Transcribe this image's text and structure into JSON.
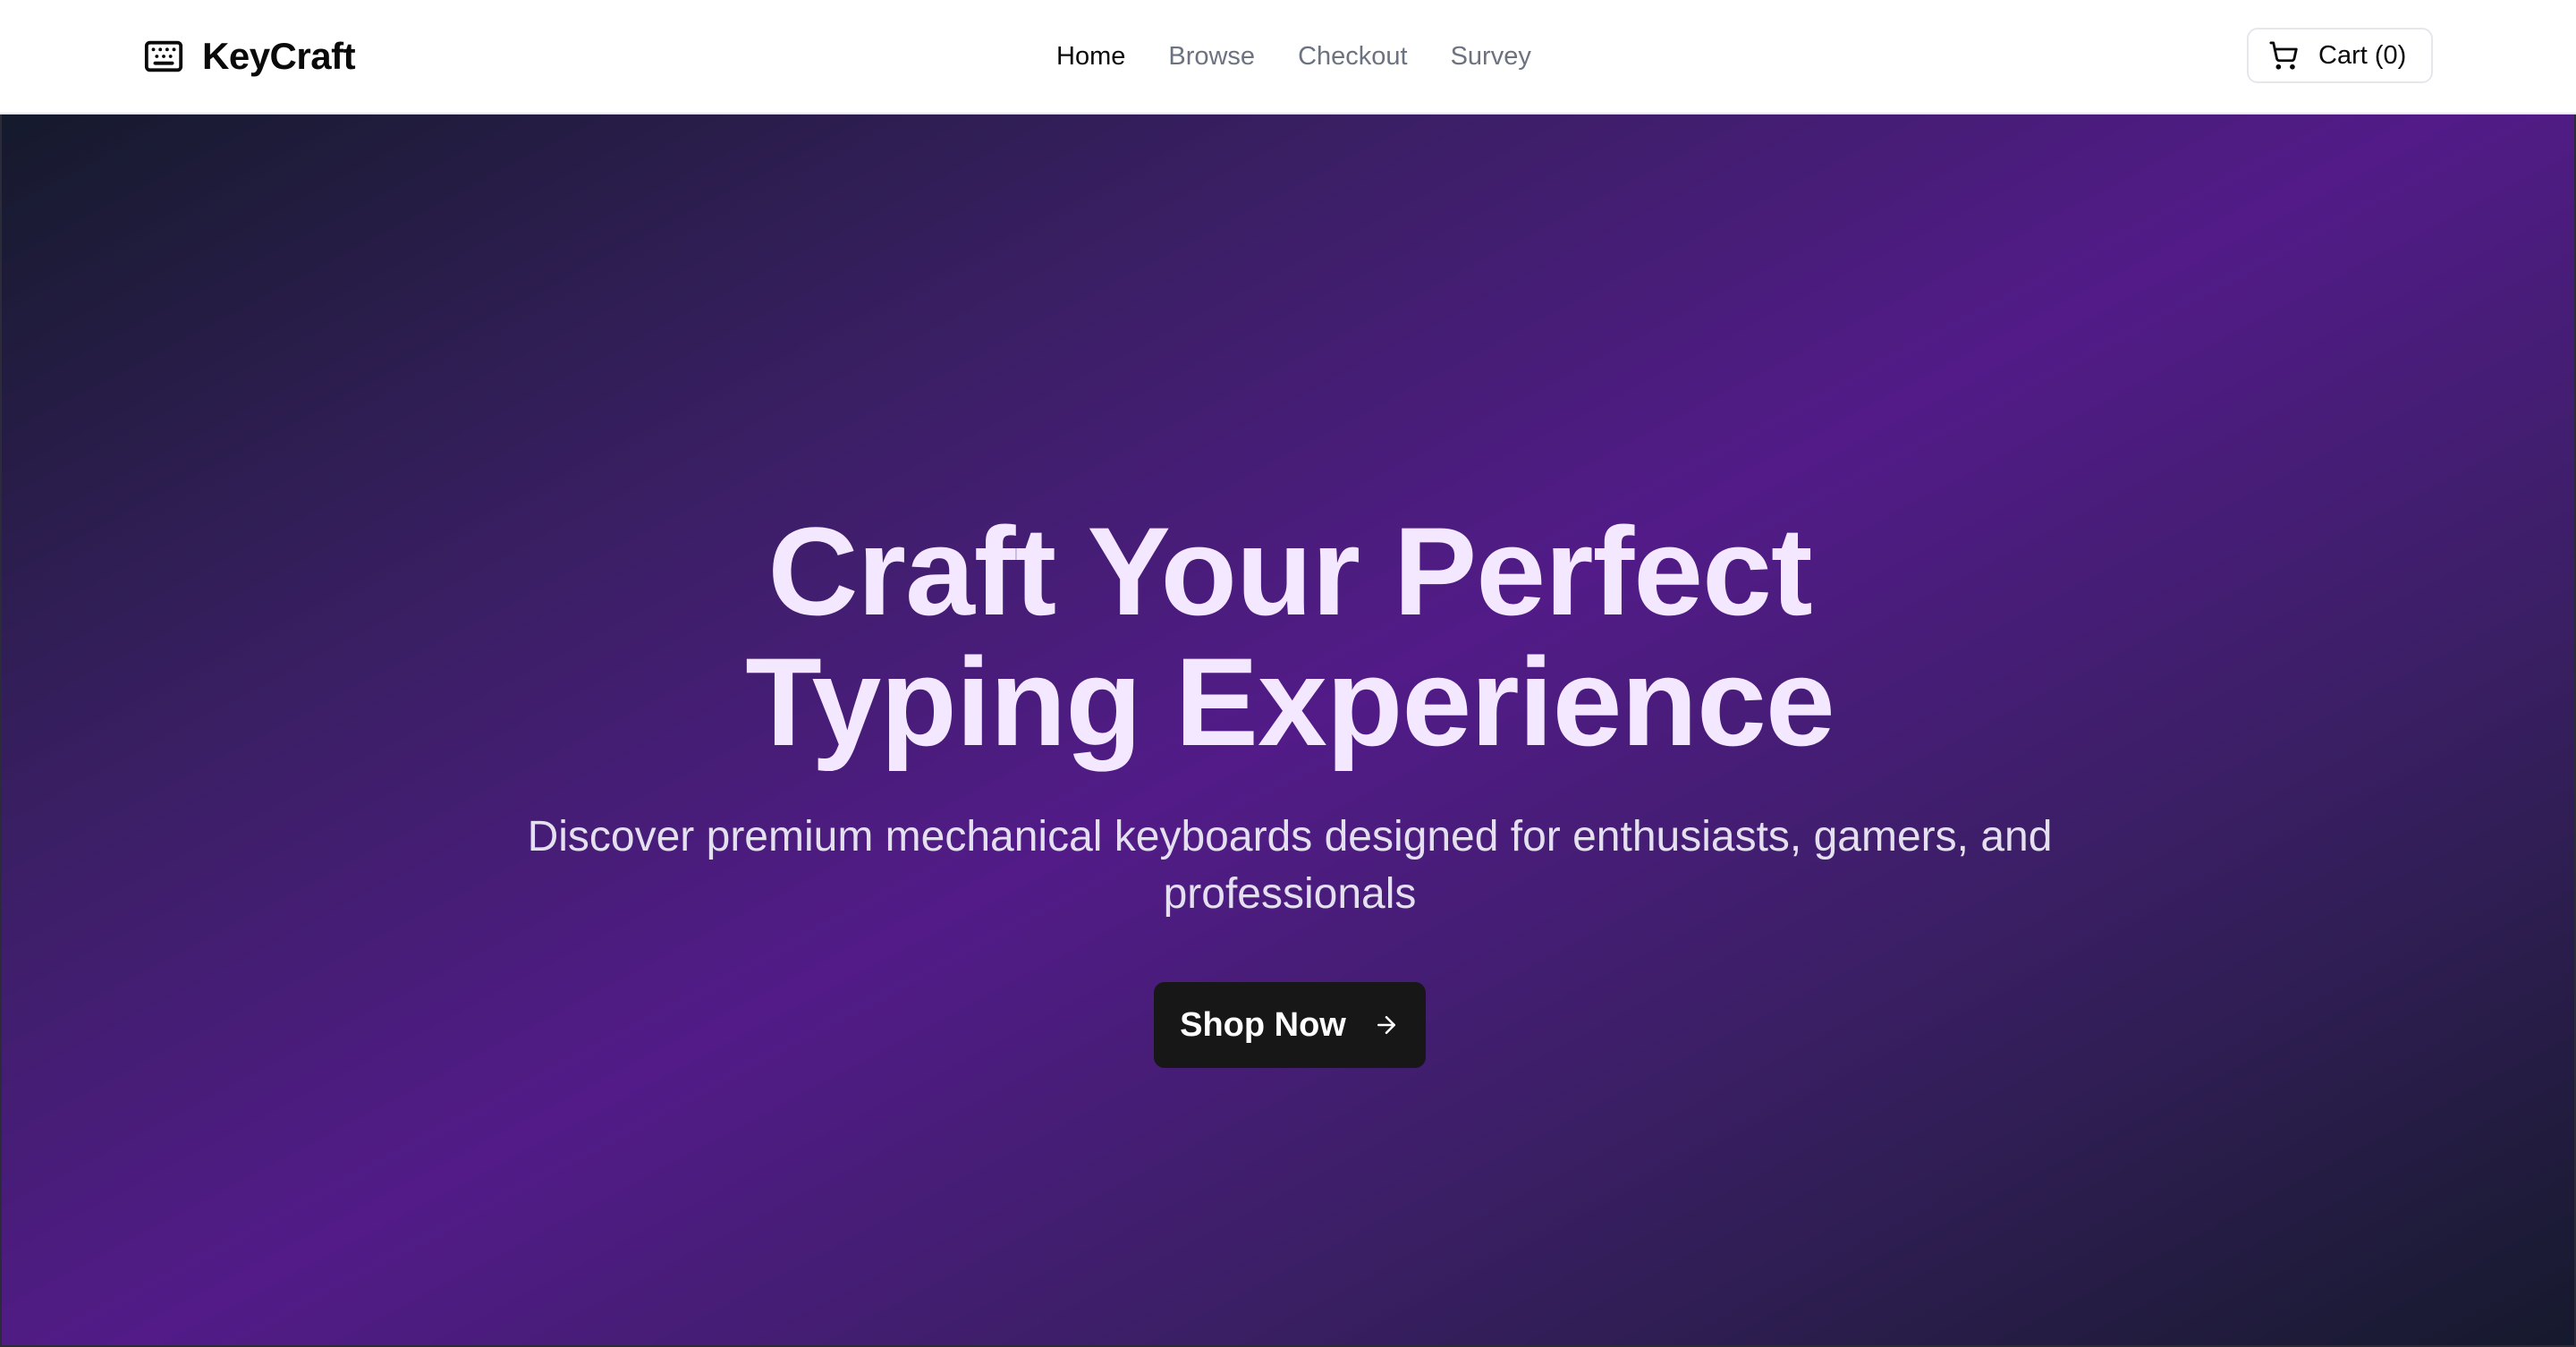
{
  "brand": {
    "name": "KeyCraft",
    "icon": "keyboard-icon"
  },
  "nav": {
    "items": [
      {
        "label": "Home",
        "active": true
      },
      {
        "label": "Browse",
        "active": false
      },
      {
        "label": "Checkout",
        "active": false
      },
      {
        "label": "Survey",
        "active": false
      }
    ]
  },
  "cart": {
    "label": "Cart (0)",
    "icon": "shopping-cart-icon"
  },
  "hero": {
    "title_line1": "Craft Your Perfect",
    "title_line2": "Typing Experience",
    "subtitle": "Discover premium mechanical keyboards designed for enthusiasts, gamers, and professionals",
    "cta_label": "Shop Now",
    "cta_icon": "arrow-right-icon"
  },
  "colors": {
    "hero_gradient_dark": "#151a2c",
    "hero_gradient_purple": "#521b88",
    "title_text": "#f3e8ff",
    "cta_background": "#171717",
    "nav_inactive": "#6b7280"
  }
}
